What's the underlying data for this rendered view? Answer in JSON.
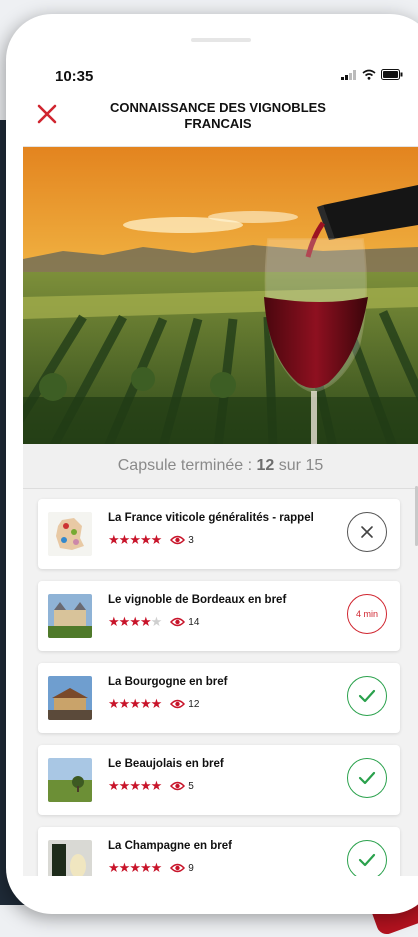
{
  "status": {
    "time": "10:35"
  },
  "header": {
    "title": "CONNAISSANCE DES VIGNOBLES FRANCAIS"
  },
  "progress": {
    "prefix": "Capsule terminée :",
    "done": "12",
    "mid": "sur",
    "total": "15"
  },
  "items": [
    {
      "title": "La France viticole généralités - rappel",
      "rating": 5,
      "views": "3",
      "action": "close-icon",
      "action_label": ""
    },
    {
      "title": "Le vignoble de Bordeaux en bref",
      "rating": 4,
      "views": "14",
      "action": "duration",
      "action_label": "4 min"
    },
    {
      "title": "La Bourgogne en bref",
      "rating": 5,
      "views": "12",
      "action": "check-icon",
      "action_label": ""
    },
    {
      "title": "Le Beaujolais en bref",
      "rating": 5,
      "views": "5",
      "action": "check-icon",
      "action_label": ""
    },
    {
      "title": "La Champagne en bref",
      "rating": 5,
      "views": "9",
      "action": "check-icon",
      "action_label": ""
    }
  ],
  "colors": {
    "accent": "#c8142a",
    "done": "#2aa14c"
  }
}
